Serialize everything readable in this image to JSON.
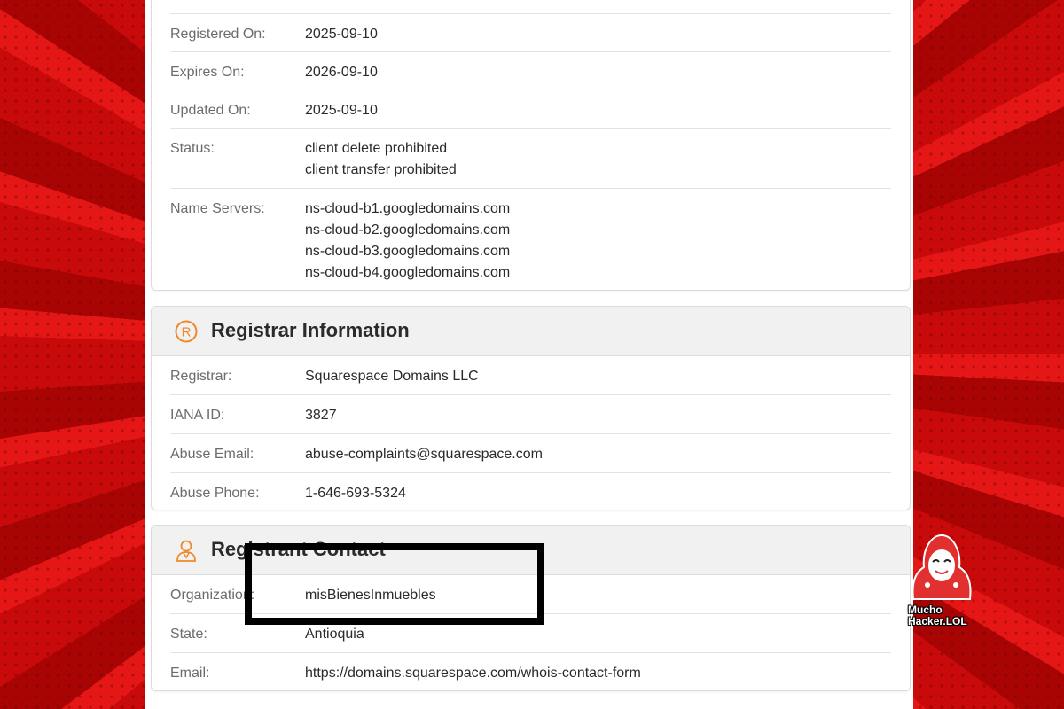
{
  "domain_card": {
    "rows": [
      {
        "label": "Registered On:",
        "values": [
          "2025-09-10"
        ]
      },
      {
        "label": "Expires On:",
        "values": [
          "2026-09-10"
        ]
      },
      {
        "label": "Updated On:",
        "values": [
          "2025-09-10"
        ]
      },
      {
        "label": "Status:",
        "values": [
          "client delete prohibited",
          "client transfer prohibited"
        ]
      },
      {
        "label": "Name Servers:",
        "values": [
          "ns-cloud-b1.googledomains.com",
          "ns-cloud-b2.googledomains.com",
          "ns-cloud-b3.googledomains.com",
          "ns-cloud-b4.googledomains.com"
        ]
      }
    ]
  },
  "registrar_card": {
    "title": "Registrar Information",
    "icon": "registered-trademark-icon",
    "rows": [
      {
        "label": "Registrar:",
        "value": "Squarespace Domains LLC"
      },
      {
        "label": "IANA ID:",
        "value": "3827"
      },
      {
        "label": "Abuse Email:",
        "value": "abuse-complaints@squarespace.com"
      },
      {
        "label": "Abuse Phone:",
        "value": "1-646-693-5324"
      }
    ]
  },
  "registrant_card": {
    "title": "Registrant Contact",
    "icon": "person-icon",
    "rows": [
      {
        "label": "Organization:",
        "value": "misBienesInmuebles"
      },
      {
        "label": "State:",
        "value": "Antioquia"
      },
      {
        "label": "Email:",
        "value": "https://domains.squarespace.com/whois-contact-form"
      }
    ]
  },
  "watermark": {
    "line1": "Mucho",
    "line2": "Hacker.LOL"
  },
  "colors": {
    "accent_orange": "#f0882c",
    "background_red": "#d40f0f"
  }
}
